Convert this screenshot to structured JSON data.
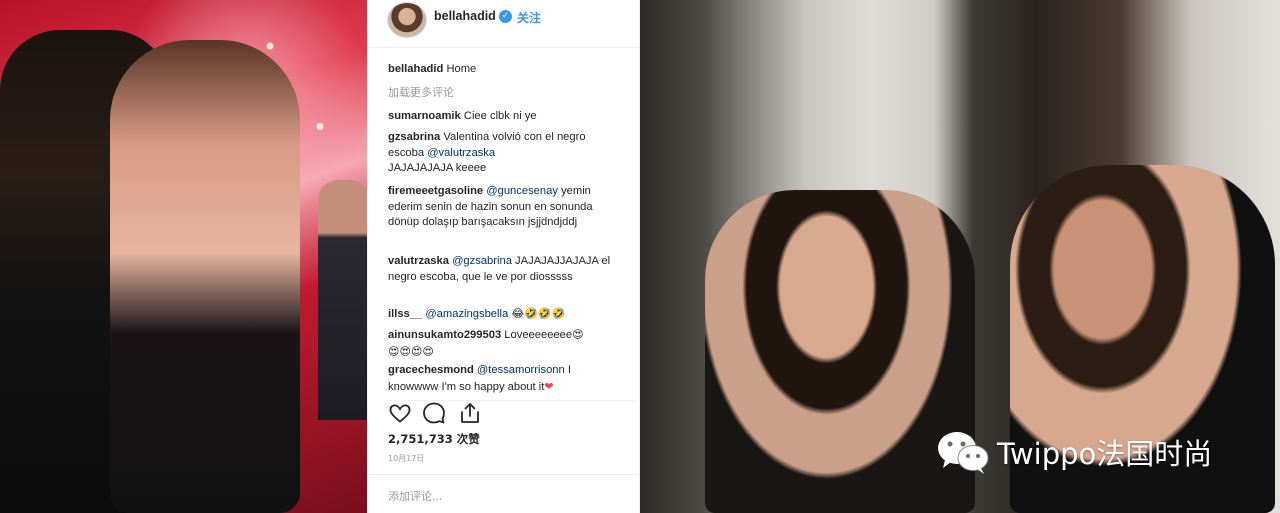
{
  "post": {
    "username": "bellahadid",
    "follow_label": "关注",
    "caption_user": "bellahadid",
    "caption_text": "Home",
    "load_more": "加载更多评论",
    "comments": [
      {
        "user": "sumarnoamik",
        "text": "Ciee clbk ni ye"
      },
      {
        "user": "gzsabrina",
        "text": "Valentina volvió con el negro escoba",
        "mention": "@valutrzaska",
        "after": "JAJAJAJAJA keeee"
      },
      {
        "user": "firemeeetgasoline",
        "mention": "@guncesenay",
        "text": "yemin ederim senin de hazin sonun en sonunda dönüp dolaşıp barışacaksın jsjjdndjddj"
      },
      {
        "user": "valutrzaska",
        "mention": "@gzsabrina",
        "text": "JAJAJAJJAJAJA el negro escoba, que le ve por diosssss"
      },
      {
        "user": "illss__",
        "mention": "@amazingsbella",
        "emoji": "😂🤣🤣🤣"
      },
      {
        "user": "ainunsukamto299503",
        "text": "Loveeeeeeee",
        "emoji": "😍",
        "emoji_line": "😍😍😍😍"
      },
      {
        "user": "gracechesmond",
        "mention": "@tessamorrisonn",
        "text": "I knowwww I'm so happy about it",
        "emoji": "❤"
      }
    ],
    "likes": "2,751,733 次赞",
    "date": "10月17日",
    "add_comment_placeholder": "添加评论..."
  },
  "icons": [
    "verified-badge-icon",
    "heart-icon",
    "comment-icon",
    "share-icon",
    "wechat-icon"
  ],
  "colors": {
    "link": "#3897f0",
    "mention": "#003569",
    "muted": "#999999",
    "text": "#262626"
  },
  "watermark": {
    "text": "Twippo法国时尚"
  }
}
